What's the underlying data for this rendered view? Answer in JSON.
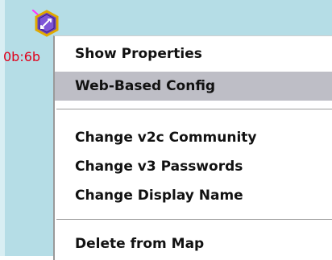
{
  "node": {
    "label": "0b:6b",
    "icon": "switch-device-icon",
    "label_color": "#e0001a"
  },
  "context_menu": {
    "items": [
      {
        "label": "Show Properties"
      },
      {
        "label": "Web-Based Config",
        "highlighted": true
      },
      {
        "label": "Change v2c Community"
      },
      {
        "label": "Change v3 Passwords"
      },
      {
        "label": "Change Display Name"
      },
      {
        "label": "Delete from Map"
      }
    ]
  },
  "colors": {
    "map_background": "#b5dde6",
    "menu_background": "#ffffff",
    "highlight": "#bebec6",
    "device_icon_fill": "#6a3fc2",
    "device_icon_border": "#e0a800"
  }
}
